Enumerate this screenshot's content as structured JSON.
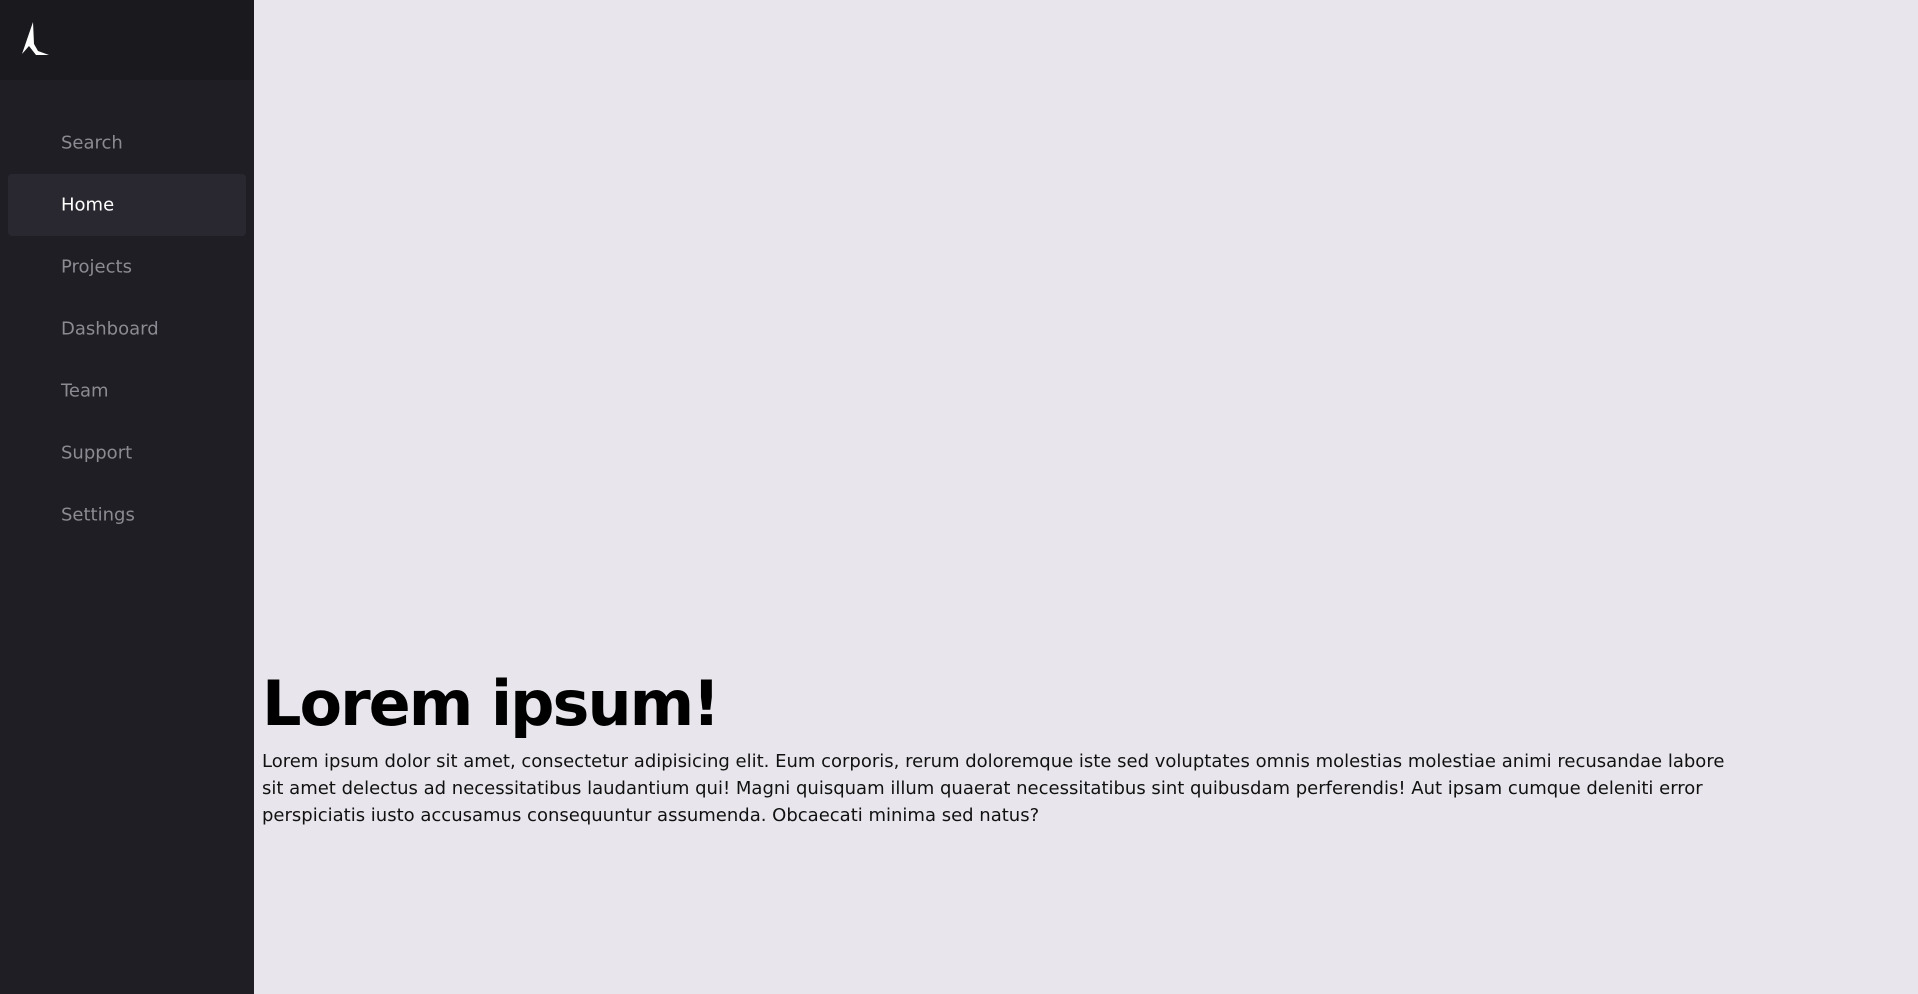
{
  "colors": {
    "sidebar_bg": "#1f1e24",
    "sidebar_header_bg": "#1a191e",
    "active_item_bg": "#29272f",
    "inactive_text": "#8c8a92",
    "active_text": "#ffffff",
    "main_bg": "#e8e6ec"
  },
  "sidebar": {
    "logo_icon": "logo-icon",
    "items": [
      {
        "label": "Search"
      },
      {
        "label": "Home",
        "active": true
      },
      {
        "label": "Projects"
      },
      {
        "label": "Dashboard"
      },
      {
        "label": "Team"
      },
      {
        "label": "Support"
      },
      {
        "label": "Settings"
      }
    ]
  },
  "main": {
    "title": "Lorem ipsum!",
    "paragraph": "Lorem ipsum dolor sit amet, consectetur adipisicing elit. Eum corporis, rerum doloremque iste sed voluptates omnis molestias molestiae animi recusandae labore sit amet delectus ad necessitatibus laudantium qui! Magni quisquam illum quaerat necessitatibus sint quibusdam perferendis! Aut ipsam cumque deleniti error perspiciatis iusto accusamus consequuntur assumenda. Obcaecati minima sed natus?"
  }
}
